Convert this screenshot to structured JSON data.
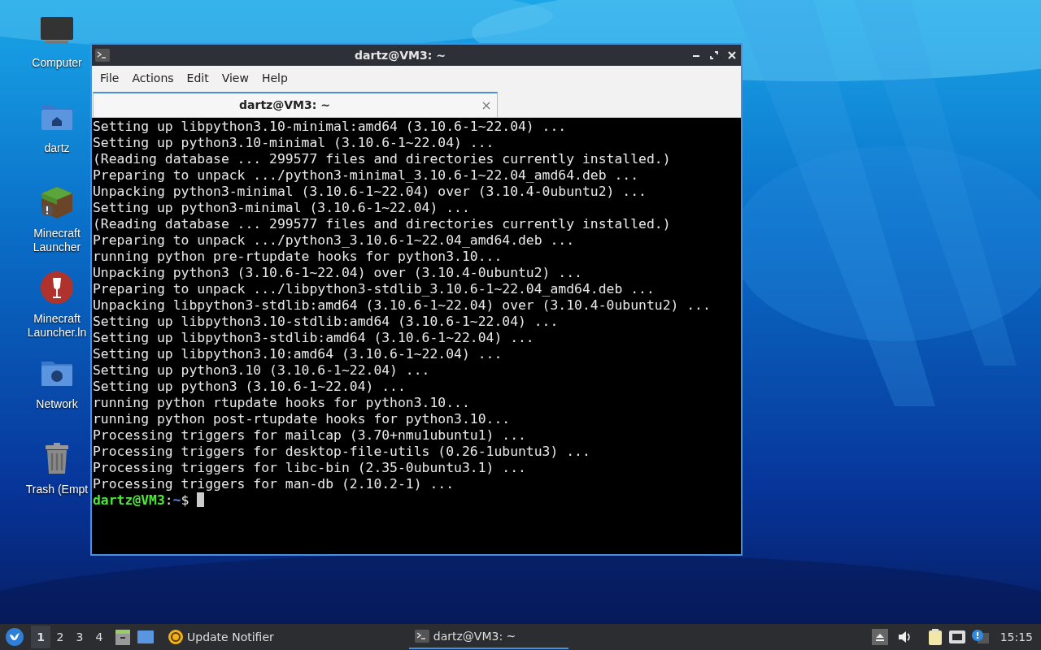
{
  "desktop_icons": [
    {
      "kind": "monitor",
      "label": "Computer"
    },
    {
      "kind": "home-folder",
      "label": "dartz"
    },
    {
      "kind": "minecraft",
      "label": "Minecraft Launcher"
    },
    {
      "kind": "wine",
      "label": "Minecraft Launcher.ln"
    },
    {
      "kind": "network-folder",
      "label": "Network"
    },
    {
      "kind": "trash",
      "label": "Trash (Empt"
    }
  ],
  "window": {
    "title": "dartz@VM3: ~",
    "menu": [
      "File",
      "Actions",
      "Edit",
      "View",
      "Help"
    ],
    "tabs": [
      {
        "label": "dartz@VM3: ~",
        "selected": true
      }
    ],
    "terminal_lines": [
      "Setting up libpython3.10-minimal:amd64 (3.10.6-1~22.04) ...",
      "Setting up python3.10-minimal (3.10.6-1~22.04) ...",
      "(Reading database ... 299577 files and directories currently installed.)",
      "Preparing to unpack .../python3-minimal_3.10.6-1~22.04_amd64.deb ...",
      "Unpacking python3-minimal (3.10.6-1~22.04) over (3.10.4-0ubuntu2) ...",
      "Setting up python3-minimal (3.10.6-1~22.04) ...",
      "(Reading database ... 299577 files and directories currently installed.)",
      "Preparing to unpack .../python3_3.10.6-1~22.04_amd64.deb ...",
      "running python pre-rtupdate hooks for python3.10...",
      "Unpacking python3 (3.10.6-1~22.04) over (3.10.4-0ubuntu2) ...",
      "Preparing to unpack .../libpython3-stdlib_3.10.6-1~22.04_amd64.deb ...",
      "Unpacking libpython3-stdlib:amd64 (3.10.6-1~22.04) over (3.10.4-0ubuntu2) ...",
      "Setting up libpython3.10-stdlib:amd64 (3.10.6-1~22.04) ...",
      "Setting up libpython3-stdlib:amd64 (3.10.6-1~22.04) ...",
      "Setting up libpython3.10:amd64 (3.10.6-1~22.04) ...",
      "Setting up python3.10 (3.10.6-1~22.04) ...",
      "Setting up python3 (3.10.6-1~22.04) ...",
      "running python rtupdate hooks for python3.10...",
      "running python post-rtupdate hooks for python3.10...",
      "Processing triggers for mailcap (3.70+nmu1ubuntu1) ...",
      "Processing triggers for desktop-file-utils (0.26-1ubuntu3) ...",
      "Processing triggers for libc-bin (2.35-0ubuntu3.1) ...",
      "Processing triggers for man-db (2.10.2-1) ..."
    ],
    "prompt": {
      "user_host": "dartz@VM3",
      "separator": ":",
      "path": "~",
      "symbol": "$"
    }
  },
  "taskbar": {
    "workspaces": [
      {
        "label": "1",
        "selected": true
      },
      {
        "label": "2",
        "selected": false
      },
      {
        "label": "3",
        "selected": false
      },
      {
        "label": "4",
        "selected": false
      }
    ],
    "tasks": [
      {
        "kind": "update",
        "label": "Update Notifier",
        "selected": false
      },
      {
        "kind": "terminal",
        "label": "dartz@VM3: ~",
        "selected": true
      }
    ],
    "clock": "15:15"
  }
}
